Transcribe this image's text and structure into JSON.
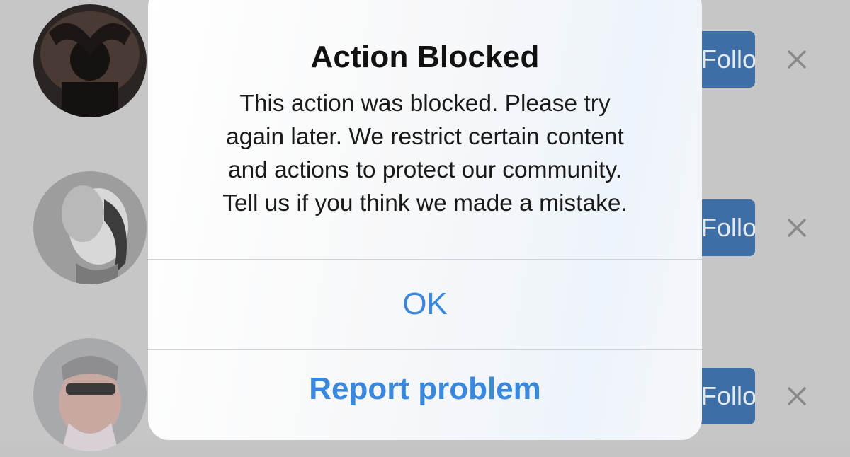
{
  "background": {
    "rows": [
      {
        "follow_label": "Follow",
        "dismiss_icon": "close-icon"
      },
      {
        "follow_label": "Follow",
        "dismiss_icon": "close-icon"
      },
      {
        "follow_label": "Follow",
        "dismiss_icon": "close-icon"
      }
    ],
    "colors": {
      "follow_button": "#3d6ea6",
      "overlay": "#c6c6c6"
    }
  },
  "alert": {
    "title": "Action Blocked",
    "message_lines": [
      "This action was blocked. Please try",
      "again later. We restrict certain content",
      "and actions to protect our community.",
      "Tell us if you think we made a mistake."
    ],
    "ok_label": "OK",
    "report_label": "Report problem",
    "colors": {
      "action_text": "#3a87de",
      "title_text": "#111111"
    }
  }
}
